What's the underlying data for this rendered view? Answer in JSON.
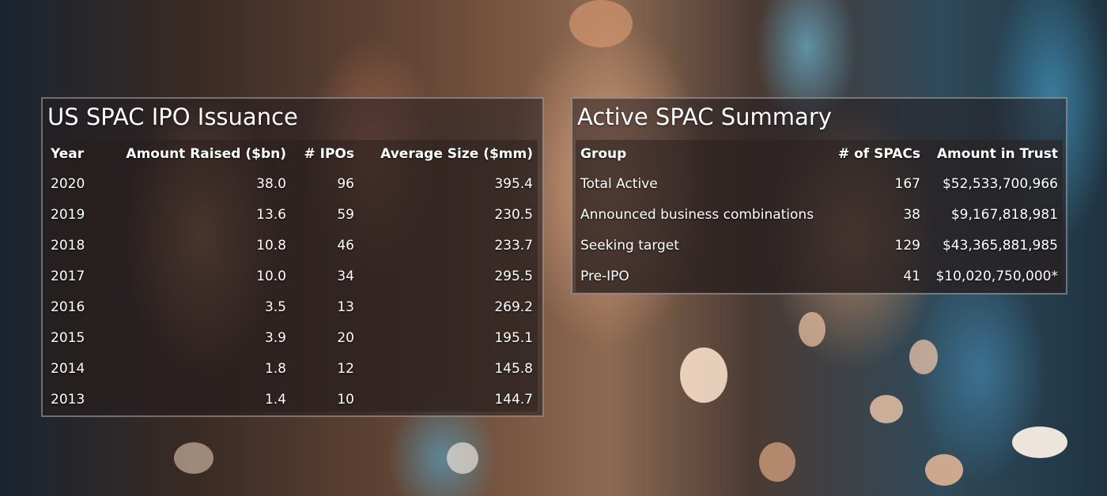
{
  "issuance": {
    "title": "US SPAC IPO Issuance",
    "columns": [
      "Year",
      "Amount Raised ($bn)",
      "# IPOs",
      "Average Size ($mm)"
    ],
    "rows": [
      [
        "2020",
        "38.0",
        "96",
        "395.4"
      ],
      [
        "2019",
        "13.6",
        "59",
        "230.5"
      ],
      [
        "2018",
        "10.8",
        "46",
        "233.7"
      ],
      [
        "2017",
        "10.0",
        "34",
        "295.5"
      ],
      [
        "2016",
        "3.5",
        "13",
        "269.2"
      ],
      [
        "2015",
        "3.9",
        "20",
        "195.1"
      ],
      [
        "2014",
        "1.8",
        "12",
        "145.8"
      ],
      [
        "2013",
        "1.4",
        "10",
        "144.7"
      ]
    ]
  },
  "summary": {
    "title": "Active SPAC Summary",
    "columns": [
      "Group",
      "# of SPACs",
      "Amount in Trust"
    ],
    "rows": [
      [
        "Total Active",
        "167",
        "$52,533,700,966"
      ],
      [
        "Announced business combinations",
        "38",
        "$9,167,818,981"
      ],
      [
        "Seeking target",
        "129",
        "$43,365,881,985"
      ],
      [
        "Pre-IPO",
        "41",
        "$10,020,750,000*"
      ]
    ]
  }
}
